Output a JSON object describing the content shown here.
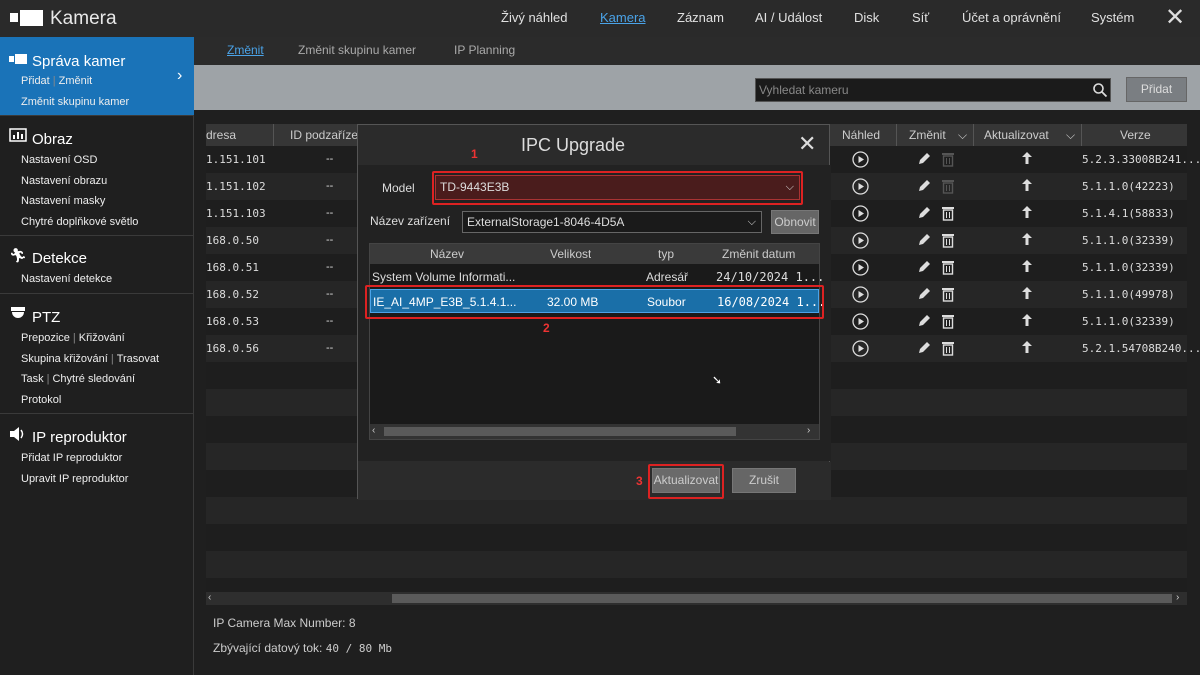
{
  "app": {
    "title": "Kamera"
  },
  "topnav": [
    "Živý náhled",
    "Kamera",
    "Záznam",
    "AI / Událost",
    "Disk",
    "Síť",
    "Účet a oprávnění",
    "Systém"
  ],
  "sidebar": {
    "sections": [
      {
        "title": "Správa kamer",
        "icon": "camera-icon",
        "rows": [
          [
            "Přidat",
            "Změnit"
          ],
          [
            "Změnit skupinu kamer"
          ]
        ]
      },
      {
        "title": "Obraz",
        "icon": "image-settings-icon",
        "rows": [
          [
            "Nastavení OSD"
          ],
          [
            "Nastavení obrazu"
          ],
          [
            "Nastavení masky"
          ],
          [
            "Chytré doplňkové světlo"
          ]
        ]
      },
      {
        "title": "Detekce",
        "icon": "running-person-icon",
        "rows": [
          [
            "Nastavení detekce"
          ]
        ]
      },
      {
        "title": "PTZ",
        "icon": "ptz-dome-icon",
        "rows": [
          [
            "Prepozice",
            "Křižování"
          ],
          [
            "Skupina křižování",
            "Trasovat"
          ],
          [
            "Task",
            "Chytré sledování"
          ],
          [
            "Protokol"
          ]
        ]
      },
      {
        "title": "IP reproduktor",
        "icon": "speaker-icon",
        "rows": [
          [
            "Přidat IP reproduktor"
          ],
          [
            "Upravit IP reproduktor"
          ]
        ]
      }
    ]
  },
  "subtabs": [
    "Změnit",
    "Změnit skupinu kamer",
    "IP Planning"
  ],
  "search": {
    "placeholder": "Vyhledat kameru"
  },
  "toolbar": {
    "add_label": "Přidat"
  },
  "table": {
    "headers": {
      "address": "dresa",
      "subid": "ID podzaříze",
      "preview": "Náhled",
      "edit": "Změnit",
      "update": "Aktualizovat",
      "version": "Verze"
    },
    "rows": [
      {
        "address": "1.151.101",
        "subid": "--",
        "version": "5.2.3.33008B241..."
      },
      {
        "address": "1.151.102",
        "subid": "--",
        "version": "5.1.1.0(42223)"
      },
      {
        "address": "1.151.103",
        "subid": "--",
        "version": "5.1.4.1(58833)"
      },
      {
        "address": "168.0.50",
        "subid": "--",
        "version": "5.1.1.0(32339)"
      },
      {
        "address": "168.0.51",
        "subid": "--",
        "version": "5.1.1.0(32339)"
      },
      {
        "address": "168.0.52",
        "subid": "--",
        "version": "5.1.1.0(49978)"
      },
      {
        "address": "168.0.53",
        "subid": "--",
        "version": "5.1.1.0(32339)"
      },
      {
        "address": "168.0.56",
        "subid": "--",
        "version": "5.2.1.54708B240..."
      }
    ]
  },
  "footer": {
    "max_label": "IP Camera Max Number: 8",
    "bitrate_label": "Zbývající datový tok:",
    "bitrate_value": "40 / 80 Mb"
  },
  "dialog": {
    "title": "IPC Upgrade",
    "model_label": "Model",
    "model_value": "TD-9443E3B",
    "device_label": "Název zařízení",
    "device_value": "ExternalStorage1-8046-4D5A",
    "refresh_label": "Obnovit",
    "file_headers": {
      "name": "Název",
      "size": "Velikost",
      "type": "typ",
      "date": "Změnit datum"
    },
    "files": [
      {
        "name": "System Volume Informati...",
        "size": "",
        "type": "Adresář",
        "date": "24/10/2024 1..."
      },
      {
        "name": "IE_AI_4MP_E3B_5.1.4.1...",
        "size": "32.00 MB",
        "type": "Soubor",
        "date": "16/08/2024 1..."
      }
    ],
    "update_label": "Aktualizovat",
    "cancel_label": "Zrušit",
    "markers": [
      "1",
      "2",
      "3"
    ]
  },
  "colors": {
    "accent": "#1a73b8",
    "link": "#4aa3e8",
    "annotation": "#dd2222",
    "selected_row": "#1a6fa8"
  }
}
